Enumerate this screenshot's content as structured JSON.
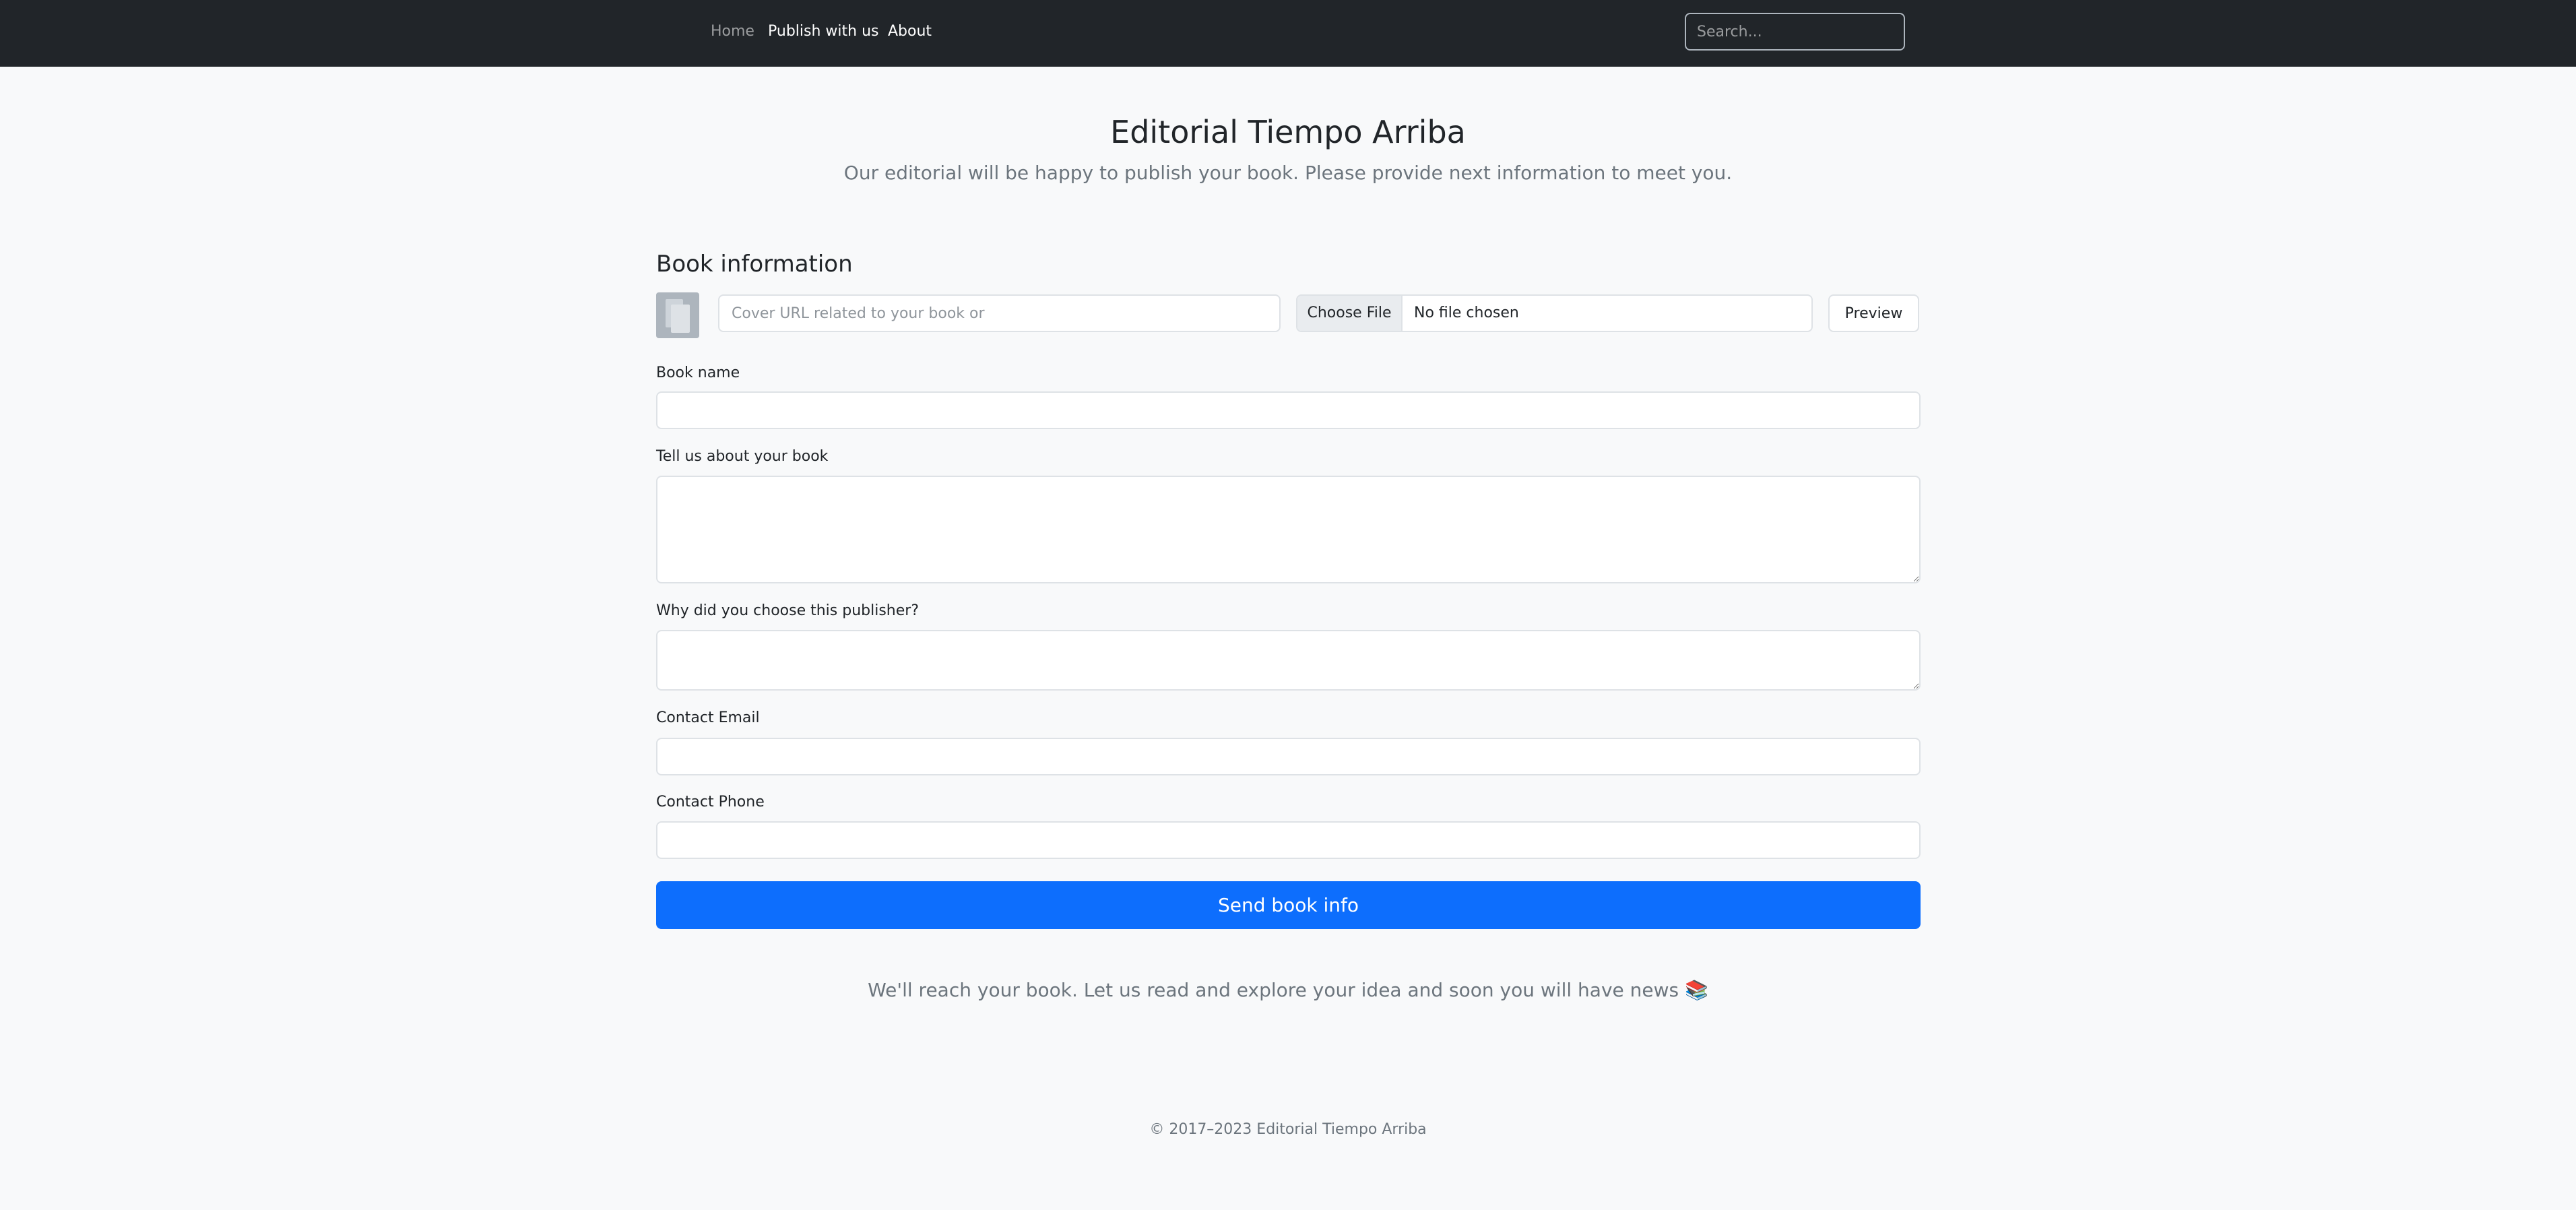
{
  "nav": {
    "links": [
      {
        "label": "Home"
      },
      {
        "label": "Publish with us"
      },
      {
        "label": "About"
      }
    ],
    "search_placeholder": "Search..."
  },
  "header": {
    "title": "Editorial Tiempo Arriba",
    "subtitle": "Our editorial will be happy to publish your book. Please provide next information to meet you."
  },
  "form": {
    "section_title": "Book information",
    "cover_url_placeholder": "Cover URL related to your book or",
    "file_button_label": "Choose File",
    "file_status": "No file chosen",
    "preview_label": "Preview",
    "book_name_label": "Book name",
    "book_name_value": "",
    "about_label": "Tell us about your book",
    "about_value": "",
    "why_label": "Why did you choose this publisher?",
    "why_value": "",
    "email_label": "Contact Email",
    "email_value": "",
    "phone_label": "Contact Phone",
    "phone_value": "",
    "submit_label": "Send book info"
  },
  "closing_message": "We'll reach your book. Let us read and explore your idea and soon you will have news 📚",
  "footer": "© 2017–2023 Editorial Tiempo Arriba",
  "colors": {
    "navbar_bg": "#212529",
    "page_bg": "#f8f9fa",
    "primary": "#0d6efd",
    "muted_text": "#6c757d"
  },
  "icons": {
    "cover_placeholder": "book-cover-placeholder-icon"
  }
}
